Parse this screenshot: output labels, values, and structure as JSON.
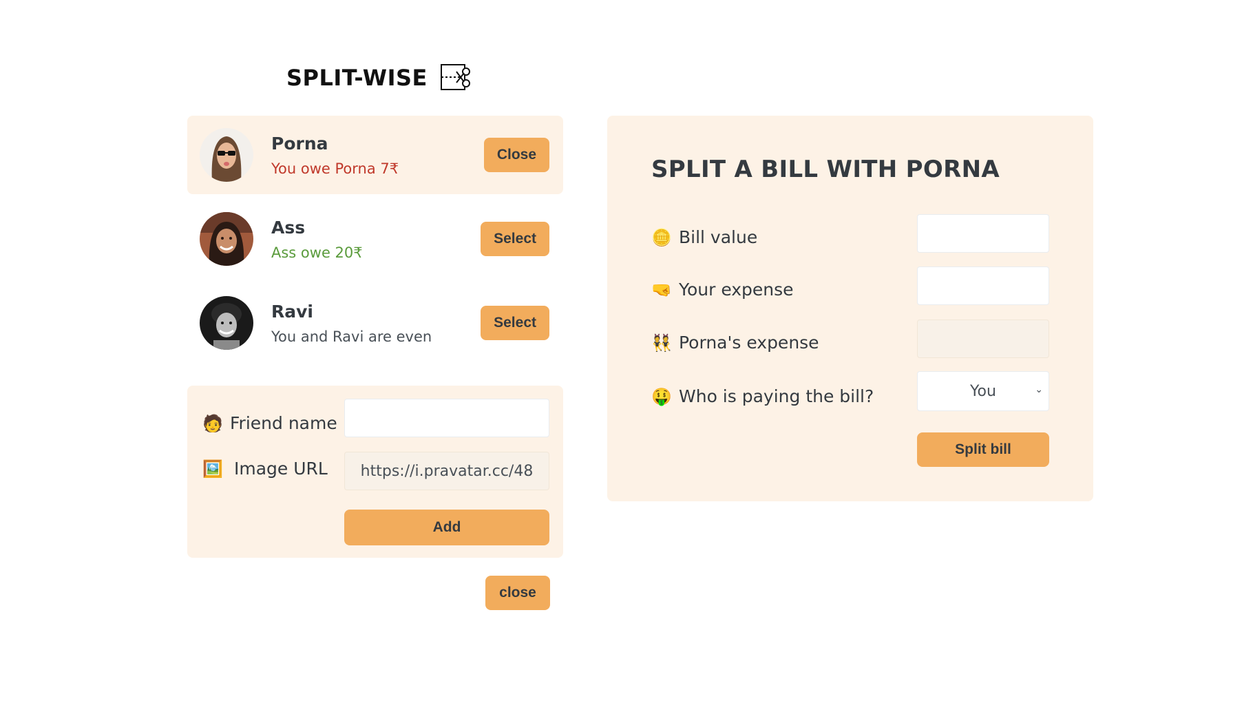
{
  "header": {
    "title": "SPLIT-WISE",
    "logo_icon": "scissors-split-icon"
  },
  "friends": [
    {
      "name": "Porna",
      "status": "You owe Porna 7₹",
      "button": "Close",
      "selected": true
    },
    {
      "name": "Ass",
      "status": "Ass owe 20₹",
      "button": "Select",
      "selected": false
    },
    {
      "name": "Ravi",
      "status": "You and Ravi are even",
      "button": "Select",
      "selected": false
    }
  ],
  "add_form": {
    "name_label": "Friend name",
    "name_icon": "🧑",
    "name_value": "",
    "image_label": "Image URL",
    "image_icon": "🖼️",
    "image_value": "https://i.pravatar.cc/48",
    "add_button": "Add"
  },
  "close_button": "close",
  "split": {
    "title": "SPLIT A BILL WITH PORNA",
    "bill_label": "Bill value",
    "bill_icon": "🪙",
    "bill_value": "",
    "your_label": "Your expense",
    "your_icon": "🤜",
    "your_value": "",
    "friend_label": "Porna's expense",
    "friend_icon": "👯",
    "friend_value": "",
    "payer_label": "Who is paying the bill?",
    "payer_icon": "🤑",
    "payer_value": "You",
    "split_button": "Split bill"
  },
  "colors": {
    "accent": "#f2ac5c",
    "panel": "#fdf2e6",
    "owe": "#c0392b",
    "owed": "#5a9b3c"
  }
}
